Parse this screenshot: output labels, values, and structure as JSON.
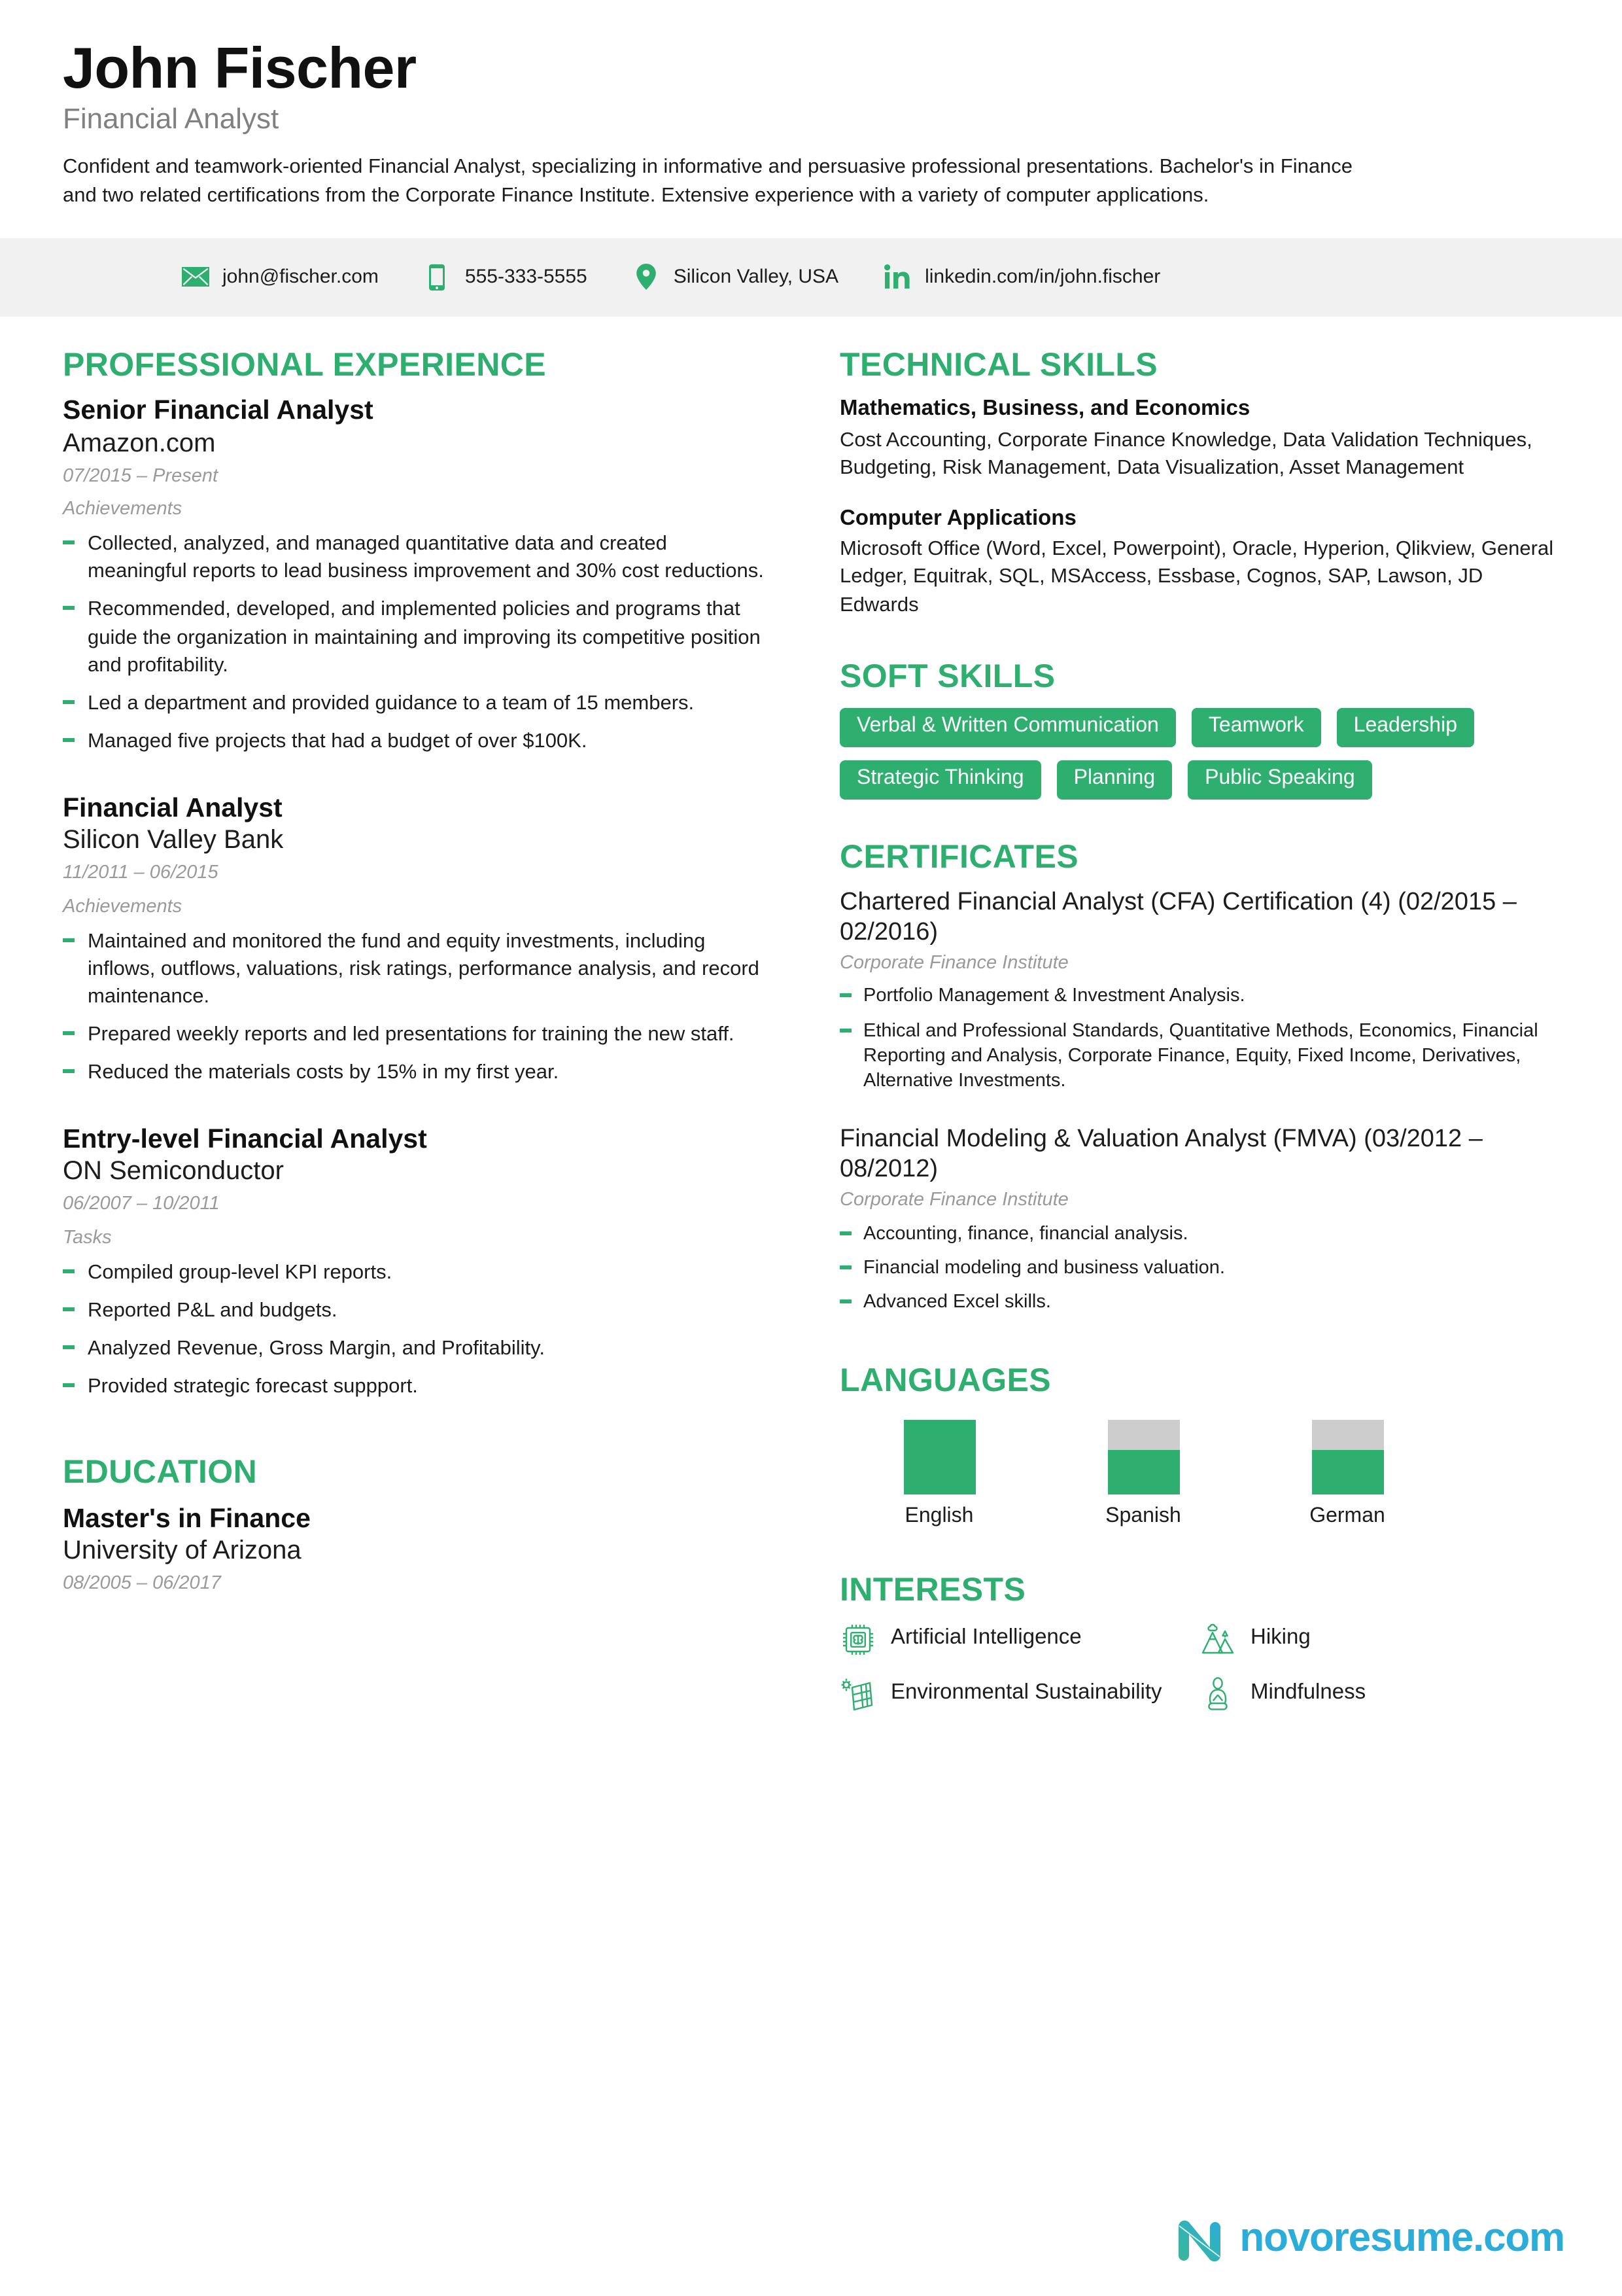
{
  "theme": {
    "accent_green": "#2EAF70",
    "contact_bar_bg": "#F1F1F1",
    "muted_gray": "#9A9A9A",
    "logo_blue": "#2CADD9"
  },
  "header": {
    "name": "John Fischer",
    "job_title": "Financial Analyst",
    "summary": "Confident and teamwork-oriented Financial Analyst, specializing in informative and persuasive professional presentations. Bachelor's in Finance and two related certifications from the Corporate Finance Institute. Extensive experience with a variety of computer applications."
  },
  "contact": [
    {
      "icon": "email-icon",
      "value": "john@fischer.com"
    },
    {
      "icon": "phone-icon",
      "value": "555-333-5555"
    },
    {
      "icon": "location-pin-icon",
      "value": "Silicon Valley, USA"
    },
    {
      "icon": "linkedin-icon",
      "value": "linkedin.com/in/john.fischer"
    }
  ],
  "experience": {
    "title": "PROFESSIONAL EXPERIENCE",
    "entries": [
      {
        "role": "Senior Financial Analyst",
        "org": "Amazon.com",
        "dates": "07/2015 – Present",
        "list_label": "Achievements",
        "bullets": [
          "Collected, analyzed, and managed quantitative data and created meaningful reports to lead business improvement and 30% cost reductions.",
          "Recommended, developed, and implemented policies and programs that guide the organization in maintaining and improving its competitive position and profitability.",
          "Led a department and provided guidance to a team of 15 members.",
          "Managed five projects that had a budget of over $100K."
        ]
      },
      {
        "role": "Financial Analyst",
        "org": "Silicon Valley Bank",
        "dates": "11/2011 – 06/2015",
        "list_label": "Achievements",
        "bullets": [
          "Maintained and monitored the fund and equity investments, including inflows, outflows, valuations, risk ratings, performance analysis, and record maintenance.",
          "Prepared weekly reports and led presentations for training the new staff.",
          "Reduced the materials costs by 15% in my first year."
        ]
      },
      {
        "role": "Entry-level Financial Analyst",
        "org": "ON Semiconductor",
        "dates": "06/2007 – 10/2011",
        "list_label": "Tasks",
        "bullets": [
          "Compiled group-level KPI reports.",
          "Reported P&L and budgets.",
          "Analyzed Revenue, Gross Margin, and Profitability.",
          "Provided strategic forecast suppport."
        ]
      }
    ]
  },
  "education": {
    "title": "EDUCATION",
    "entries": [
      {
        "degree": "Master's in Finance",
        "school": "University of Arizona",
        "dates": "08/2005 – 06/2017"
      }
    ]
  },
  "technical_skills": {
    "title": "TECHNICAL SKILLS",
    "groups": [
      {
        "heading": "Mathematics, Business, and Economics",
        "body": "Cost Accounting, Corporate Finance Knowledge, Data Validation Techniques, Budgeting, Risk Management, Data Visualization, Asset Management"
      },
      {
        "heading": "Computer Applications",
        "body": "Microsoft Office (Word, Excel, Powerpoint), Oracle, Hyperion, Qlikview, General Ledger, Equitrak, SQL, MSAccess, Essbase, Cognos, SAP, Lawson, JD Edwards"
      }
    ]
  },
  "soft_skills": {
    "title": "SOFT SKILLS",
    "items": [
      "Verbal & Written Communication",
      "Teamwork",
      "Leadership",
      "Strategic Thinking",
      "Planning",
      "Public Speaking"
    ]
  },
  "certificates": {
    "title": "CERTIFICATES",
    "entries": [
      {
        "name": "Chartered Financial Analyst (CFA) Certification (4) (02/2015 – 02/2016)",
        "issuer": "Corporate Finance Institute",
        "bullets": [
          "Portfolio Management & Investment Analysis.",
          "Ethical and Professional Standards, Quantitative Methods, Economics, Financial Reporting and Analysis, Corporate Finance, Equity, Fixed Income, Derivatives, Alternative Investments."
        ]
      },
      {
        "name": "Financial Modeling & Valuation Analyst (FMVA) (03/2012 – 08/2012)",
        "issuer": "Corporate Finance Institute",
        "bullets": [
          "Accounting, finance, financial analysis.",
          "Financial modeling and business valuation.",
          "Advanced Excel skills."
        ]
      }
    ]
  },
  "languages": {
    "title": "LANGUAGES",
    "items": [
      {
        "name": "English",
        "level_percent": 100
      },
      {
        "name": "Spanish",
        "level_percent": 60
      },
      {
        "name": "German",
        "level_percent": 60
      }
    ]
  },
  "interests": {
    "title": "INTERESTS",
    "items": [
      {
        "icon": "ai-chip-icon",
        "label": "Artificial Intelligence"
      },
      {
        "icon": "mountains-icon",
        "label": "Hiking"
      },
      {
        "icon": "solar-panel-icon",
        "label": "Environmental Sustainability"
      },
      {
        "icon": "meditation-icon",
        "label": "Mindfulness"
      }
    ]
  },
  "footer": {
    "brand": "novoresume.com"
  }
}
